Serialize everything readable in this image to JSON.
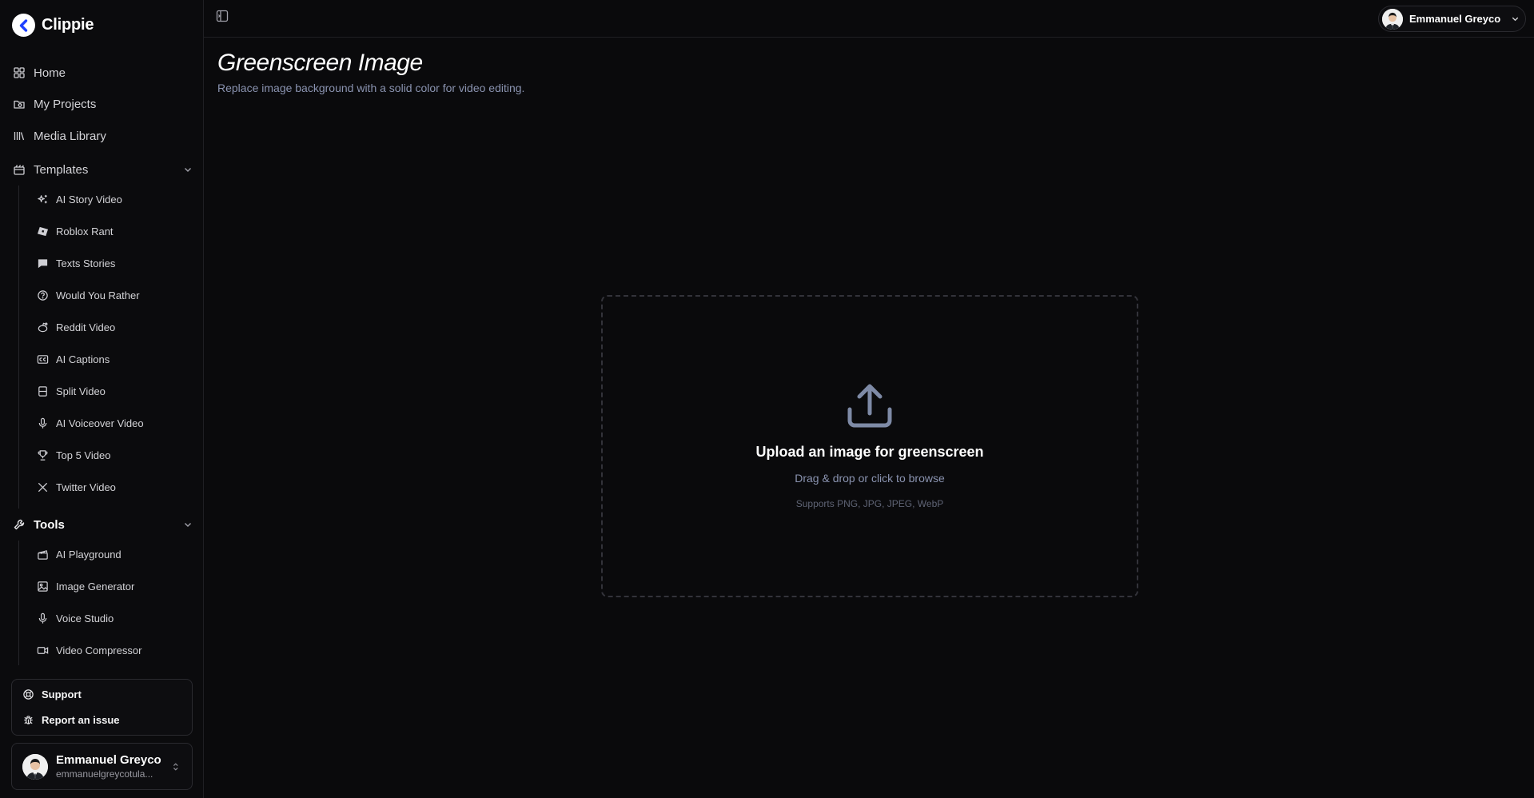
{
  "brand": {
    "name": "Clippie"
  },
  "sidebar": {
    "nav": [
      {
        "label": "Home",
        "icon": "grid-icon"
      },
      {
        "label": "My Projects",
        "icon": "folder-icon"
      },
      {
        "label": "Media Library",
        "icon": "library-icon"
      }
    ],
    "templates": {
      "label": "Templates",
      "items": [
        {
          "label": "AI Story Video",
          "icon": "sparkles-icon"
        },
        {
          "label": "Roblox Rant",
          "icon": "roblox-icon"
        },
        {
          "label": "Texts Stories",
          "icon": "message-icon"
        },
        {
          "label": "Would You Rather",
          "icon": "question-icon"
        },
        {
          "label": "Reddit Video",
          "icon": "reddit-icon"
        },
        {
          "label": "AI Captions",
          "icon": "captions-icon"
        },
        {
          "label": "Split Video",
          "icon": "split-icon"
        },
        {
          "label": "AI Voiceover Video",
          "icon": "mic-icon"
        },
        {
          "label": "Top 5 Video",
          "icon": "trophy-icon"
        },
        {
          "label": "Twitter Video",
          "icon": "x-logo-icon"
        }
      ]
    },
    "tools": {
      "label": "Tools",
      "items": [
        {
          "label": "AI Playground",
          "icon": "clapper-icon"
        },
        {
          "label": "Image Generator",
          "icon": "image-icon"
        },
        {
          "label": "Voice Studio",
          "icon": "mic-icon"
        },
        {
          "label": "Video Compressor",
          "icon": "video-icon"
        }
      ]
    },
    "support": {
      "support_label": "Support",
      "report_label": "Report an issue"
    },
    "user": {
      "name": "Emmanuel Greyco",
      "email": "emmanuelgreycotula..."
    }
  },
  "header": {
    "user_name": "Emmanuel Greyco"
  },
  "main": {
    "title": "Greenscreen Image",
    "subtitle": "Replace image background with a solid color for video editing.",
    "dropzone": {
      "title": "Upload an image for greenscreen",
      "hint": "Drag & drop or click to browse",
      "formats": "Supports PNG, JPG, JPEG, WebP"
    }
  },
  "colors": {
    "background": "#0a0a0c",
    "accent_text": "#8a93b0",
    "border": "#2a2a2f"
  }
}
